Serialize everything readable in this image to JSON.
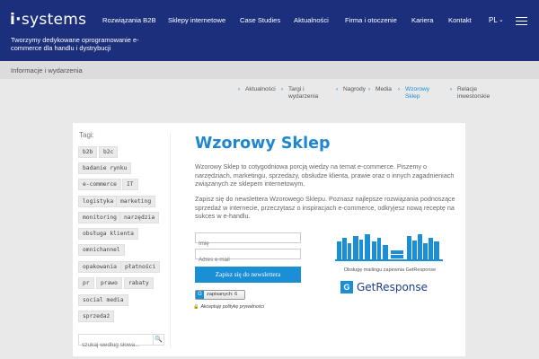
{
  "header": {
    "logo_prefix": "i·",
    "logo_text": "systems",
    "tagline": "Tworzymy dedykowane oprogramowanie e-commerce dla handlu i dystrybucji",
    "nav": [
      "Rozwiązania B2B",
      "Sklepy internetowe",
      "Case Studies",
      "Aktualności",
      "Firma i otoczenie",
      "Kariera",
      "Kontakt"
    ],
    "lang": "PL",
    "lang_chevron": "⌄"
  },
  "breadcrumb": "Informacje i wydarzenia",
  "subnav": [
    {
      "label": "Aktualności",
      "active": false
    },
    {
      "label": "Targi i wydarzenia",
      "active": false
    },
    {
      "label": "Nagrody",
      "active": false
    },
    {
      "label": "Media",
      "active": false
    },
    {
      "label": "Wzorowy Sklep",
      "active": true
    },
    {
      "label": "Relacje inwestorskie",
      "active": false
    }
  ],
  "sidebar": {
    "tags_label": "Tagi:",
    "tags": [
      "b2b",
      "b2c",
      "badanie rynku",
      "e-commerce",
      "IT",
      "logistyka",
      "marketing",
      "monitoring",
      "narzędzia",
      "obsługa klienta",
      "omnichannel",
      "opakowania",
      "płatności",
      "pr",
      "prawo",
      "rabaty",
      "social media",
      "sprzedaż"
    ],
    "search_placeholder": "szukaj według słowa...",
    "search_icon": "🔍"
  },
  "main": {
    "title": "Wzorowy Sklep",
    "intro": "Wzorowy Sklep to cotygodniowa porcją wiedzy na temat e-commerce. Piszemy o narzędziach, marketingu, sprzedaży, obsłudze klienta, prawie oraz o innych zagadnieniach związanych ze sklepem internetowym.",
    "invite": "Zapisz się do newslettera Wzorowego Sklepu. Poznasz najlepsze rozwiązania podnoszące sprzedaż w internecie, przeczytasz o inspiracjach e-commerce, odkryjesz nową receptę na sukces w e-handlu.",
    "name_placeholder": "Imię",
    "email_placeholder": "Adres e-mail",
    "subscribe_label": "Zapisz się do newslettera",
    "counter_label": "zapisanych: 6",
    "counter_icon": "G",
    "privacy_label": "Akceptuję politykę prywatności",
    "getresponse_caption": "Obsługę mailingu zapewnia GetResponse",
    "getresponse_mark": "G",
    "getresponse_word": "GetResponse"
  },
  "colors": {
    "header_bg": "#1b2f7c",
    "accent": "#1a8fd6"
  }
}
